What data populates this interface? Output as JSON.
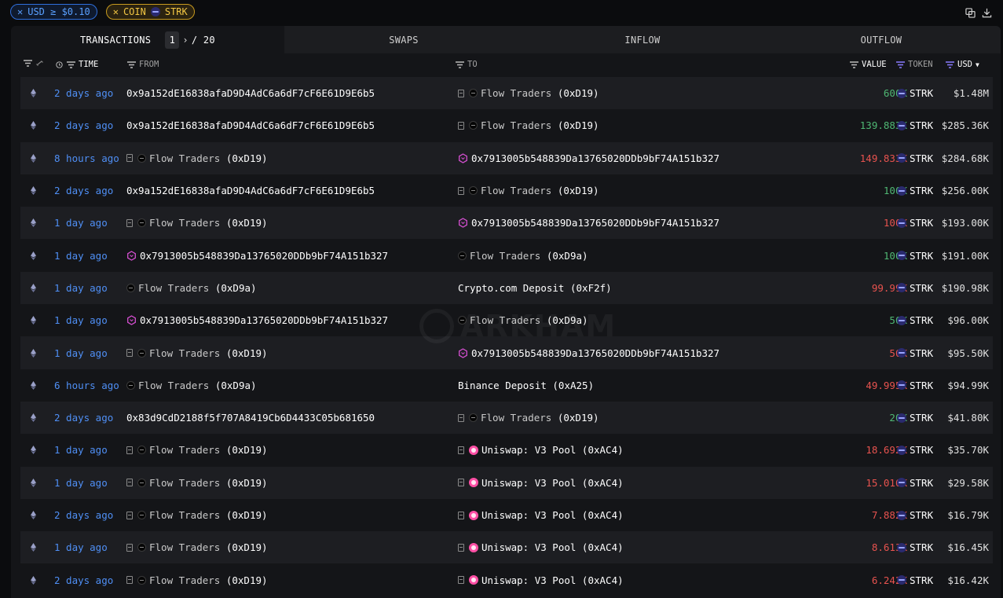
{
  "filters": {
    "usd_chip": "USD ≥ $0.10",
    "coin_chip_prefix": "COIN",
    "coin_chip_token": "STRK"
  },
  "tabs": {
    "transactions": "TRANSACTIONS",
    "page_current": "1",
    "page_total": "/ 20",
    "swaps": "SWAPS",
    "inflow": "INFLOW",
    "outflow": "OUTFLOW"
  },
  "columns": {
    "time": "TIME",
    "from": "FROM",
    "to": "TO",
    "value": "VALUE",
    "token": "TOKEN",
    "usd": "USD"
  },
  "watermark": "ARKHAM",
  "colors": {
    "inflow": "#4fb874",
    "outflow": "#e8534f",
    "time_link": "#4f8ff5"
  },
  "rows": [
    {
      "time": "2 days ago",
      "from_addr": "0x9a152dE16838afaD9D4AdC6a6dF7cF6E61D9E6b5",
      "to_name": "Flow Traders",
      "to_tag": "(0xD19)",
      "value": "600K",
      "dir": "in",
      "token": "STRK",
      "usd": "$1.48M"
    },
    {
      "time": "2 days ago",
      "from_addr": "0x9a152dE16838afaD9D4AdC6a6dF7cF6E61D9E6b5",
      "to_name": "Flow Traders",
      "to_tag": "(0xD19)",
      "value": "139.883K",
      "dir": "in",
      "token": "STRK",
      "usd": "$285.36K"
    },
    {
      "time": "8 hours ago",
      "from_name": "Flow Traders",
      "from_tag": "(0xD19)",
      "to_addr": "0x7913005b548839Da13765020DDb9bF74A151b327",
      "value": "149.833K",
      "dir": "out",
      "token": "STRK",
      "usd": "$284.68K"
    },
    {
      "time": "2 days ago",
      "from_addr": "0x9a152dE16838afaD9D4AdC6a6dF7cF6E61D9E6b5",
      "to_name": "Flow Traders",
      "to_tag": "(0xD19)",
      "value": "100K",
      "dir": "in",
      "token": "STRK",
      "usd": "$256.00K"
    },
    {
      "time": "1 day ago",
      "from_name": "Flow Traders",
      "from_tag": "(0xD19)",
      "to_addr": "0x7913005b548839Da13765020DDb9bF74A151b327",
      "value": "100K",
      "dir": "out",
      "token": "STRK",
      "usd": "$193.00K"
    },
    {
      "time": "1 day ago",
      "from_addr": "0x7913005b548839Da13765020DDb9bF74A151b327",
      "to_name": "Flow Traders",
      "to_tag": "(0xD9a)",
      "value": "100K",
      "dir": "in",
      "token": "STRK",
      "usd": "$191.00K"
    },
    {
      "time": "1 day ago",
      "from_name": "Flow Traders",
      "from_tag": "(0xD9a)",
      "to_plain": "Crypto.com Deposit (0xF2f)",
      "value": "99.99K",
      "dir": "out",
      "token": "STRK",
      "usd": "$190.98K"
    },
    {
      "time": "1 day ago",
      "from_addr": "0x7913005b548839Da13765020DDb9bF74A151b327",
      "to_name": "Flow Traders",
      "to_tag": "(0xD9a)",
      "value": "50K",
      "dir": "in",
      "token": "STRK",
      "usd": "$96.00K"
    },
    {
      "time": "1 day ago",
      "from_name": "Flow Traders",
      "from_tag": "(0xD19)",
      "to_addr": "0x7913005b548839Da13765020DDb9bF74A151b327",
      "value": "50K",
      "dir": "out",
      "token": "STRK",
      "usd": "$95.50K"
    },
    {
      "time": "6 hours ago",
      "from_name": "Flow Traders",
      "from_tag": "(0xD9a)",
      "to_plain": "Binance Deposit (0xA25)",
      "value": "49.995K",
      "dir": "out",
      "token": "STRK",
      "usd": "$94.99K"
    },
    {
      "time": "2 days ago",
      "from_addr": "0x83d9CdD2188f5f707A8419Cb6D4433C05b681650",
      "to_name": "Flow Traders",
      "to_tag": "(0xD19)",
      "value": "20K",
      "dir": "in",
      "token": "STRK",
      "usd": "$41.80K"
    },
    {
      "time": "1 day ago",
      "from_name": "Flow Traders",
      "from_tag": "(0xD19)",
      "to_uni": "Uniswap: V3 Pool (0xAC4)",
      "value": "18.692K",
      "dir": "out",
      "token": "STRK",
      "usd": "$35.70K"
    },
    {
      "time": "1 day ago",
      "from_name": "Flow Traders",
      "from_tag": "(0xD19)",
      "to_uni": "Uniswap: V3 Pool (0xAC4)",
      "value": "15.016K",
      "dir": "out",
      "token": "STRK",
      "usd": "$29.58K"
    },
    {
      "time": "2 days ago",
      "from_name": "Flow Traders",
      "from_tag": "(0xD19)",
      "to_uni": "Uniswap: V3 Pool (0xAC4)",
      "value": "7.882K",
      "dir": "out",
      "token": "STRK",
      "usd": "$16.79K"
    },
    {
      "time": "1 day ago",
      "from_name": "Flow Traders",
      "from_tag": "(0xD19)",
      "to_uni": "Uniswap: V3 Pool (0xAC4)",
      "value": "8.613K",
      "dir": "out",
      "token": "STRK",
      "usd": "$16.45K"
    },
    {
      "time": "2 days ago",
      "from_name": "Flow Traders",
      "from_tag": "(0xD19)",
      "to_uni": "Uniswap: V3 Pool (0xAC4)",
      "value": "6.242K",
      "dir": "out",
      "token": "STRK",
      "usd": "$16.42K"
    }
  ]
}
